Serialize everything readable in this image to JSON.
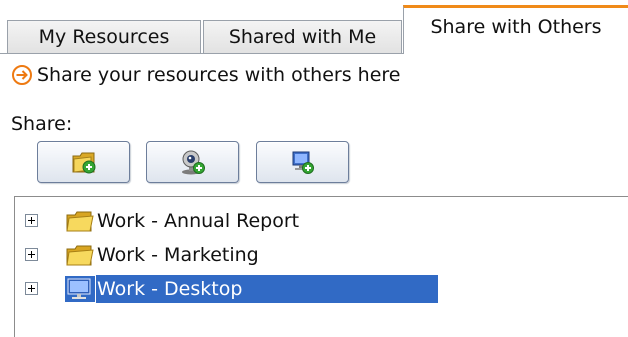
{
  "tabs": [
    {
      "label": "My Resources"
    },
    {
      "label": "Shared with Me"
    },
    {
      "label": "Share with Others",
      "active": true
    }
  ],
  "info": {
    "icon": "arrow-circle-icon",
    "text": "Share your resources with others here"
  },
  "share": {
    "label": "Share:",
    "buttons": [
      {
        "icon": "add-folder-icon"
      },
      {
        "icon": "add-webcam-icon"
      },
      {
        "icon": "add-desktop-icon"
      }
    ]
  },
  "tree": {
    "items": [
      {
        "label": "Work - Annual Report",
        "icon": "folder-icon",
        "selected": false
      },
      {
        "label": "Work - Marketing",
        "icon": "folder-icon",
        "selected": false
      },
      {
        "label": "Work - Desktop",
        "icon": "desktop-icon",
        "selected": true
      }
    ]
  },
  "colors": {
    "accent": "#f08a18",
    "selection": "#316ac5"
  }
}
